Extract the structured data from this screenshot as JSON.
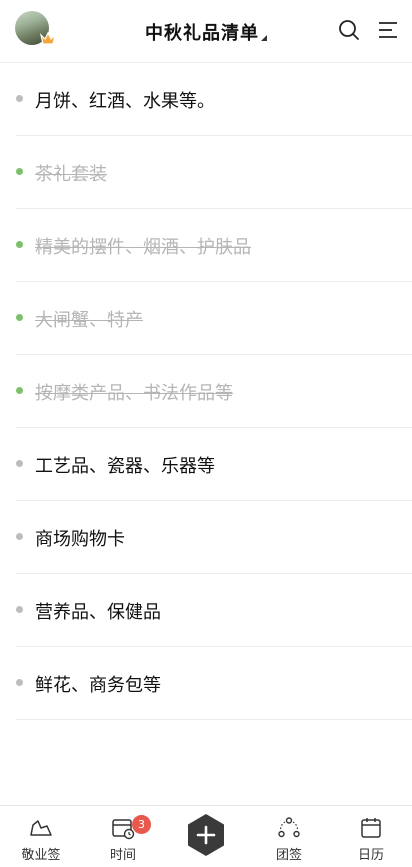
{
  "header": {
    "title": "中秋礼品清单",
    "avatar_icon": "user-avatar",
    "search_icon": "search-icon",
    "menu_icon": "menu-icon"
  },
  "list": {
    "items": [
      {
        "text": "月饼、红酒、水果等。",
        "done": false
      },
      {
        "text": "茶礼套装",
        "done": true
      },
      {
        "text": "精美的摆件、烟酒、护肤品",
        "done": true
      },
      {
        "text": "大闸蟹、特产",
        "done": true
      },
      {
        "text": "按摩类产品、书法作品等",
        "done": true
      },
      {
        "text": "工艺品、瓷器、乐器等",
        "done": false
      },
      {
        "text": "商场购物卡",
        "done": false
      },
      {
        "text": "营养品、保健品",
        "done": false
      },
      {
        "text": "鲜花、商务包等",
        "done": false
      }
    ]
  },
  "tabbar": {
    "tabs": [
      {
        "label": "敬业签",
        "icon": "note-icon"
      },
      {
        "label": "时间",
        "icon": "calendar-clock-icon",
        "badge": "3"
      },
      {
        "label": "",
        "icon": "add-icon"
      },
      {
        "label": "团签",
        "icon": "group-icon"
      },
      {
        "label": "日历",
        "icon": "calendar-icon"
      }
    ]
  },
  "colors": {
    "done_dot": "#7cc06b",
    "pending_dot": "#bdbdbd",
    "badge": "#e8584c",
    "add_button": "#3a3a3a"
  }
}
